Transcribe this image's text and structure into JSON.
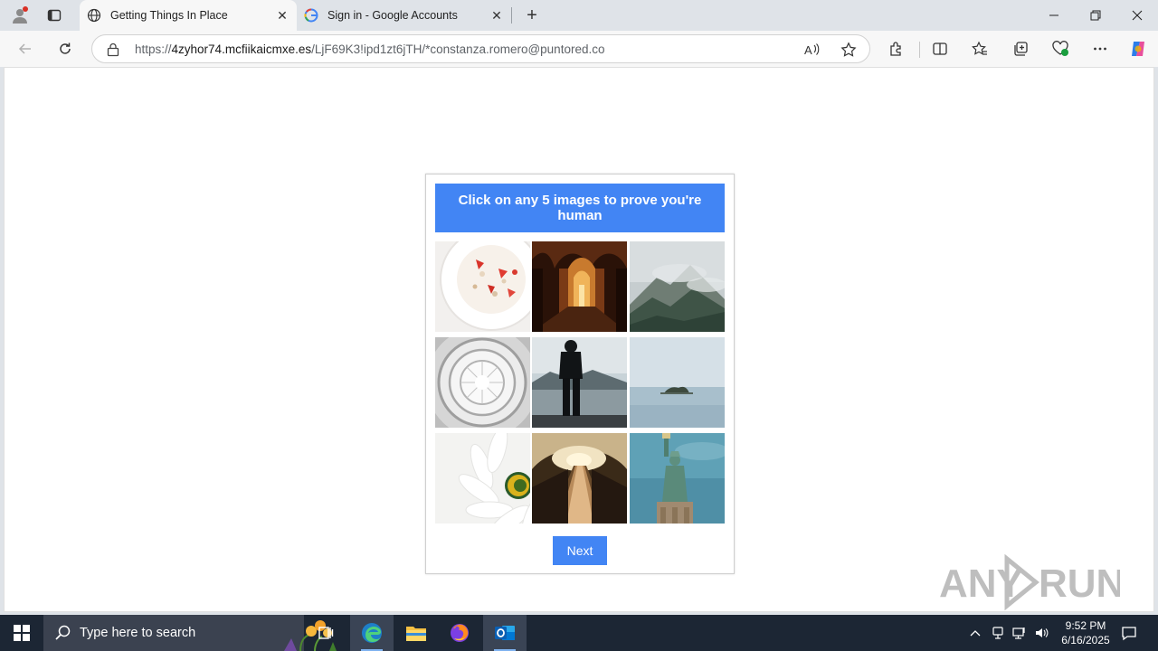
{
  "browser": {
    "tabs": [
      {
        "title": "Getting Things In Place",
        "active": true
      },
      {
        "title": "Sign in - Google Accounts",
        "active": false
      }
    ],
    "url": {
      "prefix": "https://",
      "host": "4zyhor74.mcfiikaicmxe.es",
      "path": "/LjF69K3!ipd1zt6jTH/*constanza.romero@puntored.co"
    }
  },
  "captcha": {
    "heading": "Click on any 5 images to prove you're human",
    "images": [
      {
        "subject": "strawberry yogurt bowl"
      },
      {
        "subject": "arched corridor"
      },
      {
        "subject": "misty mountain"
      },
      {
        "subject": "spiral atrium dome"
      },
      {
        "subject": "person at foggy lake"
      },
      {
        "subject": "small island in calm sea"
      },
      {
        "subject": "white daisy"
      },
      {
        "subject": "escalator tunnel"
      },
      {
        "subject": "statue of liberty"
      }
    ],
    "next_label": "Next",
    "accent_color": "#4285f4"
  },
  "watermark": "ANY RUN",
  "taskbar": {
    "search_placeholder": "Type here to search",
    "time": "9:52 PM",
    "date": "6/16/2025"
  }
}
